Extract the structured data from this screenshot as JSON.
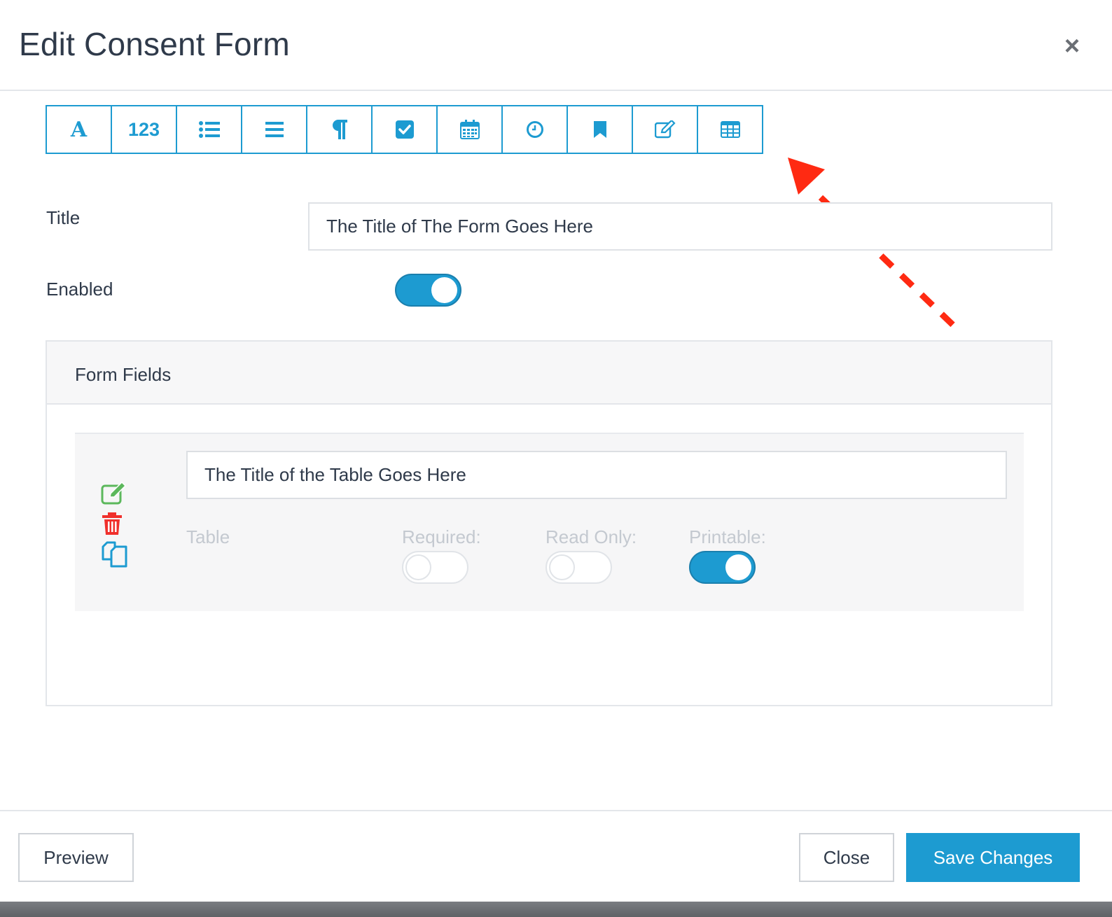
{
  "modal": {
    "title": "Edit Consent Form",
    "close_glyph": "×"
  },
  "toolbar": {
    "buttons": [
      {
        "name": "text-field",
        "label": "A",
        "icon": "font-icon"
      },
      {
        "name": "number-field",
        "label": "123",
        "icon": "number-icon"
      },
      {
        "name": "list-field",
        "icon": "list-ul-icon"
      },
      {
        "name": "align-field",
        "icon": "align-justify-icon"
      },
      {
        "name": "paragraph-field",
        "icon": "paragraph-icon"
      },
      {
        "name": "checkbox-field",
        "icon": "check-square-icon"
      },
      {
        "name": "date-field",
        "icon": "calendar-icon"
      },
      {
        "name": "time-field",
        "icon": "clock-icon"
      },
      {
        "name": "bookmark-field",
        "icon": "bookmark-icon"
      },
      {
        "name": "signature-field",
        "icon": "edit-icon"
      },
      {
        "name": "table-field",
        "icon": "table-icon"
      }
    ],
    "accent_color": "#1d9bd1"
  },
  "annotation": {
    "arrow_color": "#ff2a12",
    "style": "dashed-arrow"
  },
  "form": {
    "title_label": "Title",
    "title_value": "The Title of The Form Goes Here",
    "enabled_label": "Enabled",
    "enabled": true
  },
  "form_fields": {
    "heading": "Form Fields",
    "items": [
      {
        "title_value": "The Title of the Table Goes Here",
        "type_label": "Table",
        "required_label": "Required:",
        "required": false,
        "read_only_label": "Read Only:",
        "read_only": false,
        "printable_label": "Printable:",
        "printable": true,
        "actions": [
          "edit-icon",
          "trash-icon",
          "copy-icon"
        ]
      }
    ]
  },
  "footer": {
    "preview_label": "Preview",
    "close_label": "Close",
    "save_label": "Save Changes"
  },
  "colors": {
    "primary": "#1d9bd1",
    "edit_green": "#5cb85c",
    "delete_red": "#f0302c",
    "text": "#2f3a4a",
    "muted": "#c4c9d0"
  }
}
